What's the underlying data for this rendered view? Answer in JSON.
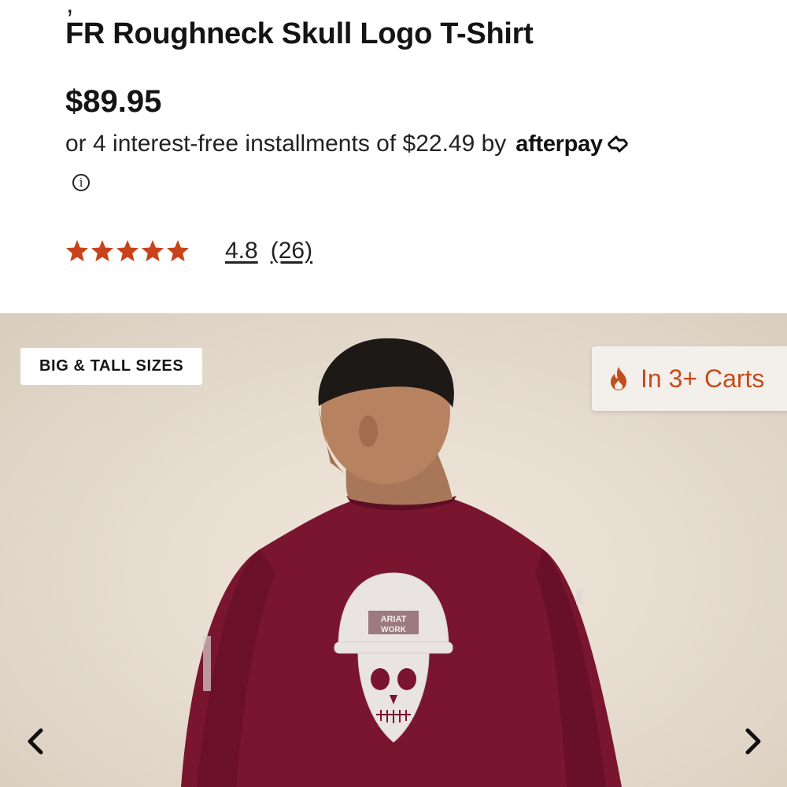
{
  "product": {
    "title": "FR Roughneck Skull Logo T-Shirt",
    "price": "$89.95",
    "installment_text": "or 4 interest-free installments of $22.49 by",
    "installment_provider": "afterpay",
    "rating": "4.8",
    "review_count": "(26)",
    "star_count": 5,
    "star_color": "#c9421a"
  },
  "gallery": {
    "badge_sizes": "BIG & TALL SIZES",
    "badge_carts": "In 3+ Carts",
    "badge_carts_color": "#c24d1e",
    "prev_icon": "chevron-left-icon",
    "next_icon": "chevron-right-icon",
    "image": {
      "description_icon": "product-photo",
      "shirt_print_text": [
        "ARIAT",
        "WORK"
      ]
    }
  }
}
